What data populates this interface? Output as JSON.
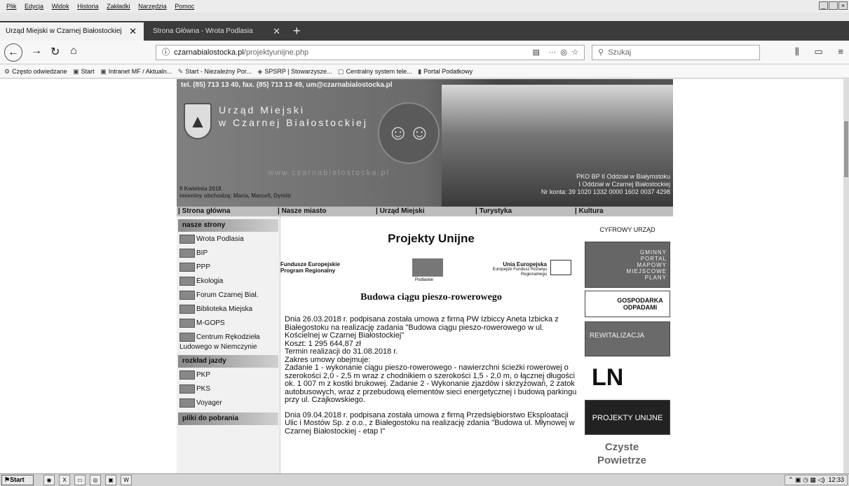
{
  "menu": [
    "Plik",
    "Edycja",
    "Widok",
    "Historia",
    "Zakładki",
    "Narzędzia",
    "Pomoc"
  ],
  "window_controls": [
    "_",
    " ",
    "×"
  ],
  "tabs": [
    {
      "label": "Urząd Miejski w Czarnej Białostockiej"
    },
    {
      "label": "Strona Główna - Wrota Podlasia"
    }
  ],
  "url": {
    "host": "czarnabialostocka.pl",
    "path": "/projektyunijne.php"
  },
  "search_placeholder": "Szukaj",
  "bookmarks": [
    "Często odwiedzane",
    "Start",
    "Intranet MF / Aktualn...",
    "Start - Niezależny Por...",
    "SPSRP | Stowarzysze...",
    "Centralny system tele...",
    "Portal Podatkowy"
  ],
  "site": {
    "contact": "tel. (85) 713 13 40, fax. (85) 713 13 49,  um@czarnabialostocka.pl",
    "title_line1": "Urząd Miejski",
    "title_line2": "w Czarnej Białostockiej",
    "www": "www.czarnabialostocka.pl",
    "date": "9 Kwietnia 2018",
    "names": "imieniny obchodzą: Maria, Marcell, Dymitr",
    "bank1": "PKO BP II Oddział w Białymstoku",
    "bank2": "I Oddział w Czarnej Białostockiej",
    "bank3": "Nr konta: 39 1020 1332 0000 1602 0037 4298",
    "topnav": [
      "| Strona główna",
      "| Nasze miasto",
      "| Urząd Miejski",
      "| Turystyka",
      "| Kultura"
    ],
    "side_head1": "nasze strony",
    "side_items1": [
      "Wrota Podlasia",
      "BIP",
      "PPP",
      "Ekologia",
      "Forum Czarnej Biał.",
      "Biblioteka Miejska",
      "M-GOPS",
      "Centrum Rękodzieła Ludowego w Niemczynie"
    ],
    "side_head2": "rozkład jazdy",
    "side_items2": [
      "PKP",
      "PKS",
      "Voyager"
    ],
    "side_head3": "pliki do pobrania",
    "page_title": "Projekty Unijne",
    "logo_left": "Fundusze Europejskie",
    "logo_left_sub": "Program Regionalny",
    "logo_mid": "Podlaskie",
    "logo_right": "Unia Europejska",
    "logo_right_sub": "Europejski Fundusz Rozwoju Regionalnego",
    "section_title": "Budowa ciągu pieszo-rowerowego",
    "para1": "Dnia 26.03.2018 r. podpisana została umowa z firmą PW Izbiccy Aneta Izbicka z Białegostoku na realizację zadania \"Budowa ciągu pieszo-rowerowego w ul. Kościelnej w Czarnej Białostockiej\"",
    "koszt": "Koszt: 1 295 644,87 zł",
    "termin": "Termin realizacji do 31.08.2018 r.",
    "zakres": "Zakres umowy obejmuje:",
    "zadanie": "Zadanie 1 - wykonanie ciągu pieszo-rowerowego - nawierzchni ścieżki rowerowej o szerokości 2,0 - 2,5 m wraz z chodnikiem o szerokości 1,5 - 2,0 m, o łącznej długości ok. 1 007 m z kostki brukowej. Zadanie 2 - Wykonanie zjazdów i skrzyżowań, 2 zatok autobusowych, wraz z przebudową elementów sieci energetycznej i budową parkingu przy ul. Czajkowskiego.",
    "para2": "Dnia 09.04.2018 r. podpisana została umowa z firmą Przedsiębiorstwo Eksploatacji Ulic i Mostów Sp. z o.o., z Białegostoku na realizację zdania \"Budowa ul. Młynowej w Czarnej Białostockiej - etap I\"",
    "right_items": [
      "CYFROWY URZĄD",
      "GMINNY PORTAL MAPOWY MIEJSCOWE PLANY",
      "GOSPODARKA ODPADAMI",
      "REWITALIZACJA",
      "LN",
      "PROJEKTY UNIJNE",
      "Czyste Powietrze"
    ]
  },
  "taskbar": {
    "start": "Start",
    "clock": "12:33"
  }
}
